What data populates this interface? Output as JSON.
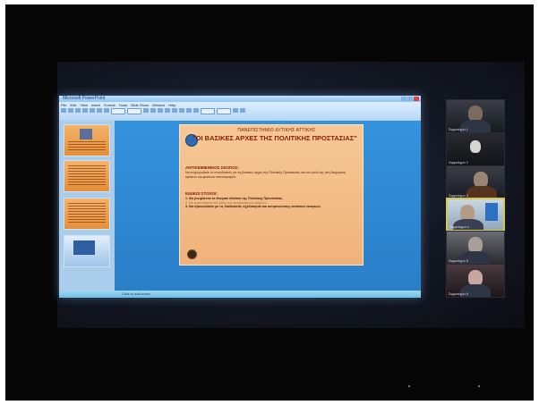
{
  "window": {
    "title_text": "Microsoft PowerPoint",
    "menu": [
      "File",
      "Edit",
      "View",
      "Insert",
      "Format",
      "Tools",
      "Slide Show",
      "Window",
      "Help"
    ],
    "notes_placeholder": "Click to add notes"
  },
  "slide": {
    "header": "ΠΑΝΕΠΙΣΤΗΜΙΟ ΔΥΤΙΚΗΣ ΑΤΤΙΚΗΣ",
    "title": "\"ΟΙ ΒΑΣΙΚΕΣ ΑΡΧΕΣ ΤΗΣ ΠΟΛΙΤΙΚΗΣ ΠΡΟΣΤΑΣΙΑΣ\"",
    "section1": "ΑΝΤΙΚΕΙΜΕΝΙΚΟΣ ΣΚΟΠΟΣ:",
    "text1": "Να ενημερωθούν οι σπουδαστές για τις βασικές αρχές της Πολιτικής Προστασίας και τον ρόλο της στη διαχείριση κρίσεων και φυσικών καταστροφών.",
    "section2": "ΕΙΔΙΚΟΙ ΣΤΟΧΟΙ:",
    "text2_a": "1. Να γνωρίσουν το θεσμικό πλαίσιο της Πολιτικής Προστασίας.",
    "text2_b": "2. Να κατανοήσουν τον ρόλο των εμπλεκόμενων φορέων.",
    "text2_c": "3. Να εξοικειωθούν με τις διαδικασίες σχεδιασμού και αντιμετώπισης εκτάκτων αναγκών."
  },
  "participants": [
    {
      "name": "Συμμετέχων 1"
    },
    {
      "name": "Συμμετέχων 2"
    },
    {
      "name": "Συμμετέχων 3"
    },
    {
      "name": "Συμμετέχων 4"
    },
    {
      "name": "Συμμετέχων 5"
    },
    {
      "name": "Συμμετέχων 6"
    }
  ],
  "colors": {
    "slide_bg": "#f0b27a",
    "workspace_bg": "#2d86cf",
    "active_speaker_border": "#d8c84a"
  }
}
